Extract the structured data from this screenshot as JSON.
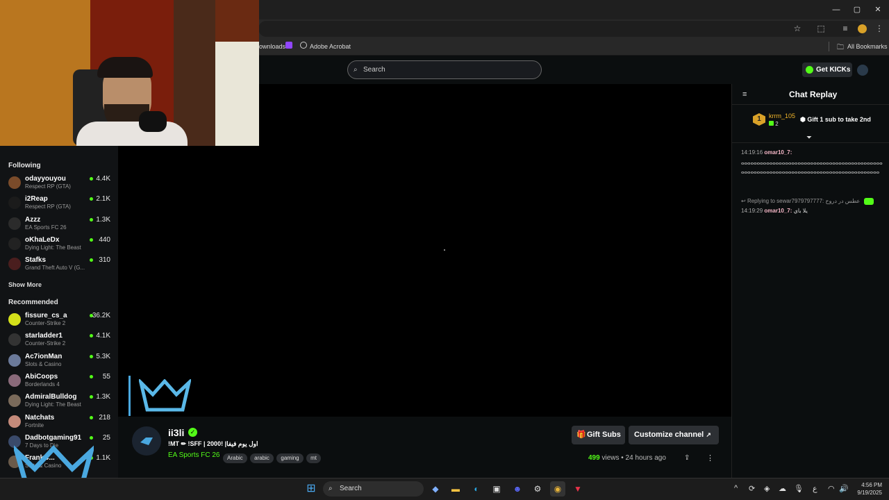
{
  "browser": {
    "bookmarks": [
      "ownloads",
      "Adobe Acrobat"
    ],
    "all_bookmarks": "All Bookmarks"
  },
  "header": {
    "search_placeholder": "Search",
    "get_kicks": "Get KICKs"
  },
  "sidebar": {
    "following_title": "Following",
    "following": [
      {
        "name": "odayyouyou",
        "game": "Respect RP (GTA)",
        "viewers": "4.4K",
        "color": "#7a4b2a"
      },
      {
        "name": "i2Reap",
        "game": "Respect RP (GTA)",
        "viewers": "2.1K",
        "color": "#1b1b1b"
      },
      {
        "name": "Azzz",
        "game": "EA Sports FC 26",
        "viewers": "1.3K",
        "color": "#2b2b2b"
      },
      {
        "name": "oKhaLeDx",
        "game": "Dying Light: The Beast",
        "viewers": "440",
        "color": "#222"
      },
      {
        "name": "Stafks",
        "game": "Grand Theft Auto V (G...",
        "viewers": "310",
        "color": "#4a1e1e"
      }
    ],
    "show_more": "Show More",
    "recommended_title": "Recommended",
    "recommended": [
      {
        "name": "fissure_cs_a",
        "game": "Counter-Strike 2",
        "viewers": "36.2K",
        "color": "#d4e01a"
      },
      {
        "name": "starladder1",
        "game": "Counter-Strike 2",
        "viewers": "4.1K",
        "color": "#333"
      },
      {
        "name": "Ac7ionMan",
        "game": "Slots & Casino",
        "viewers": "5.3K",
        "color": "#6b7a9a"
      },
      {
        "name": "AbiCoops",
        "game": "Borderlands 4",
        "viewers": "55",
        "color": "#8a6a7a"
      },
      {
        "name": "AdmiralBulldog",
        "game": "Dying Light: The Beast",
        "viewers": "1.3K",
        "color": "#7a6a5a"
      },
      {
        "name": "Natchats",
        "game": "Fortnite",
        "viewers": "218",
        "color": "#c48a7a"
      },
      {
        "name": "Dadbotgaming91",
        "game": "7 Days to Die",
        "viewers": "25",
        "color": "#3a4a6a"
      },
      {
        "name": "FrankC...",
        "game": "Slots & Casino",
        "viewers": "1.1K",
        "color": "#6a5a4a"
      }
    ]
  },
  "stream": {
    "channel": "ii3li",
    "title": "!MT ✏ !SFF | 2000! |اول يوم فيفا",
    "category": "EA Sports FC 26",
    "tags": [
      "Arabic",
      "arabic",
      "gaming",
      "mt"
    ],
    "views_count": "499",
    "views_label": "views",
    "time_ago": "24 hours ago",
    "gift_subs": "Gift Subs",
    "customize": "Customize channel"
  },
  "chat": {
    "title": "Chat Replay",
    "top_gifter_name": "krrm_105",
    "top_gifter_count": "2",
    "top_gifter_rank": "1",
    "gift_prompt": "Gift 1 sub to take 2nd",
    "messages": [
      {
        "time": "14:19:16",
        "user": "omar10_7:",
        "text": "ⴰⴰⴰⴰⴰⴰⴰⴰⴰⴰⴰⴰⴰⴰⴰⴰⴰⴰⴰⴰⴰⴰⴰⴰⴰⴰⴰⴰⴰⴰⴰⴰⴰⴰⴰⴰⴰⴰⴰⴰⴰⴰⴰⴰⴰⴰⴰⴰⴰⴰⴰⴰⴰⴰⴰⴰⴰⴰⴰⴰⴰⴰⴰⴰⴰⴰⴰⴰⴰⴰⴰⴰⴰⴰⴰⴰⴰⴰⴰⴰⴰⴰⴰⴰⴰⴰⴰⴰⴰ"
      },
      {
        "reply_to": "Replying to sewar7979797777: عطس در دروح",
        "time": "14:19:29",
        "user": "omar10_7:",
        "text": "يلا باي"
      }
    ]
  },
  "taskbar": {
    "search": "Search",
    "time": "4:56 PM",
    "date": "9/19/2025",
    "lang": "ع"
  },
  "colors": {
    "kick_green": "#53fc18",
    "chat_user": "#f7b8c8"
  }
}
